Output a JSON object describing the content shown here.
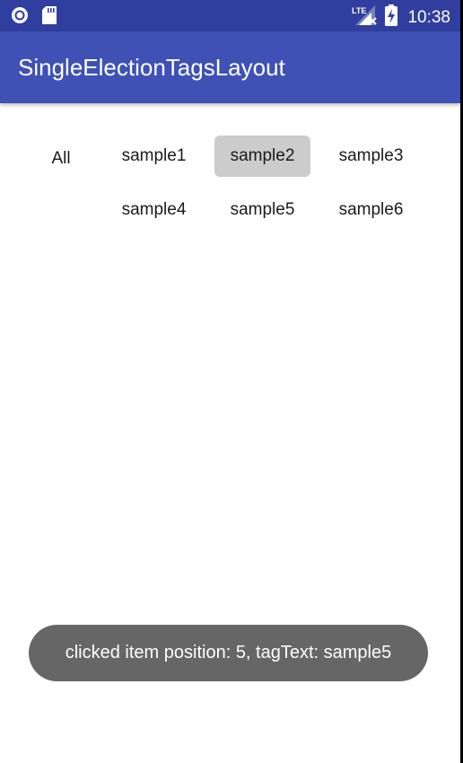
{
  "status_bar": {
    "left_icons": [
      "sync-circle-icon",
      "sd-card-icon"
    ],
    "network_label": "LTE",
    "right_icons": [
      "signal-icon",
      "battery-charging-icon"
    ],
    "time": "10:38"
  },
  "app_bar": {
    "title": "SingleElectionTagsLayout"
  },
  "tags": {
    "all_label": "All",
    "items": [
      {
        "label": "sample1",
        "selected": false
      },
      {
        "label": "sample2",
        "selected": true
      },
      {
        "label": "sample3",
        "selected": false
      },
      {
        "label": "sample4",
        "selected": false
      },
      {
        "label": "sample5",
        "selected": false
      },
      {
        "label": "sample6",
        "selected": false
      }
    ]
  },
  "toast": {
    "message": "clicked item position: 5, tagText: sample5"
  },
  "colors": {
    "status_bar": "#303f9f",
    "app_bar": "#3f51b5",
    "selected_tag": "#cccccc",
    "toast_bg": "#666666"
  }
}
